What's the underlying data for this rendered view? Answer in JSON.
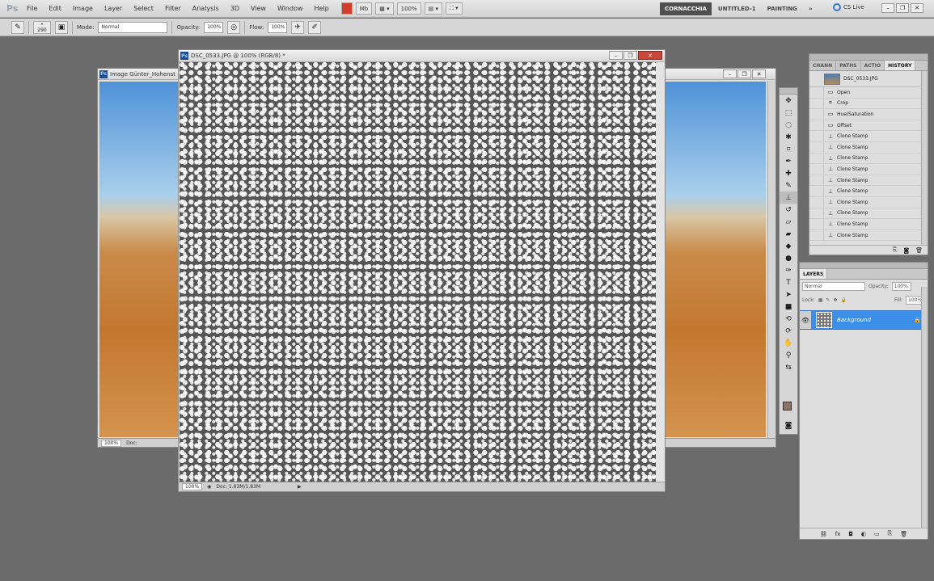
{
  "app": {
    "logo": "Ps"
  },
  "menu": [
    "File",
    "Edit",
    "Image",
    "Layer",
    "Select",
    "Filter",
    "Analysis",
    "3D",
    "View",
    "Window",
    "Help"
  ],
  "menubar_tools": {
    "zoom": "100%"
  },
  "workspaces": [
    "CORNACCHIA",
    "UNTITLED-1",
    "PAINTING"
  ],
  "workspace_more": "»",
  "cs_live": "CS Live",
  "options_bar": {
    "brush_size": "290",
    "mode_label": "Mode:",
    "mode_value": "Normal",
    "opacity_label": "Opacity:",
    "opacity_value": "100%",
    "flow_label": "Flow:",
    "flow_value": "100%"
  },
  "doc_left": {
    "title": "Image Günter_Hohenst",
    "zoom": "100%",
    "status": "Doc:"
  },
  "doc_main": {
    "title": "DSC_0533.JPG @ 100% (RGB/8) *",
    "zoom": "100%",
    "status": "Doc: 1.83M/1.83M"
  },
  "history_panel": {
    "tabs": [
      "CHANN",
      "PATHS",
      "ACTIO",
      "HISTORY"
    ],
    "snapshot": "DSC_0533.JPG",
    "items": [
      {
        "icon": "open-icon",
        "label": "Open"
      },
      {
        "icon": "crop-icon",
        "label": "Crop"
      },
      {
        "icon": "adjustment-icon",
        "label": "Hue/Saturation"
      },
      {
        "icon": "filter-icon",
        "label": "Offset"
      },
      {
        "icon": "clone-stamp-icon",
        "label": "Clone Stamp"
      },
      {
        "icon": "clone-stamp-icon",
        "label": "Clone Stamp"
      },
      {
        "icon": "clone-stamp-icon",
        "label": "Clone Stamp"
      },
      {
        "icon": "clone-stamp-icon",
        "label": "Clone Stamp"
      },
      {
        "icon": "clone-stamp-icon",
        "label": "Clone Stamp"
      },
      {
        "icon": "clone-stamp-icon",
        "label": "Clone Stamp"
      },
      {
        "icon": "clone-stamp-icon",
        "label": "Clone Stamp"
      },
      {
        "icon": "clone-stamp-icon",
        "label": "Clone Stamp"
      },
      {
        "icon": "clone-stamp-icon",
        "label": "Clone Stamp"
      },
      {
        "icon": "clone-stamp-icon",
        "label": "Clone Stamp"
      }
    ]
  },
  "layers_panel": {
    "tab": "LAYERS",
    "blend_mode": "Normal",
    "opacity_label": "Opacity:",
    "opacity_value": "100%",
    "lock_label": "Lock:",
    "fill_label": "Fill:",
    "fill_value": "100%",
    "layer_name": "Background"
  },
  "colors": {
    "foreground": "#8f7466",
    "background": "#111111",
    "selection": "#3b8fe8"
  }
}
